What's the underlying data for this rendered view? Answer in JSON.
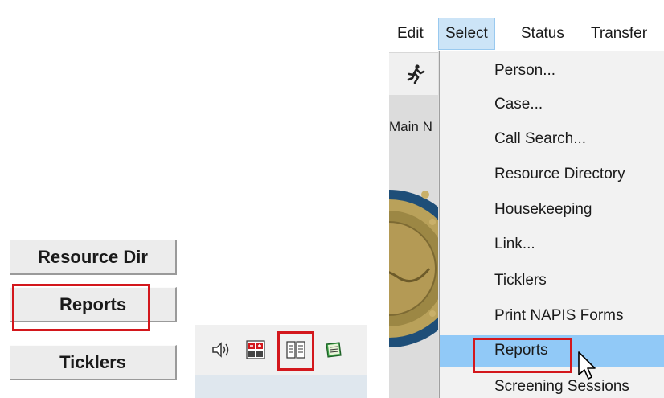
{
  "left_panel": {
    "buttons": {
      "resource_dir": "Resource Dir",
      "reports": "Reports",
      "ticklers": "Ticklers"
    }
  },
  "toolbar_icons": [
    "speaker-icon",
    "calculator-icon",
    "report-icon",
    "notepad-icon"
  ],
  "menu": {
    "top_items": {
      "edit": "Edit",
      "select": "Select",
      "status": "Status",
      "transfer": "Transfer"
    },
    "window_label": "Main N",
    "dropdown": [
      "Person...",
      "Case...",
      "Call Search...",
      "Resource Directory",
      "Housekeeping",
      "Link...",
      "Ticklers",
      "Print NAPIS Forms",
      "Reports",
      "Screening Sessions"
    ],
    "selected_item": "Reports"
  },
  "highlight_color": "#d3171c",
  "selection_color": "#91c9f7"
}
